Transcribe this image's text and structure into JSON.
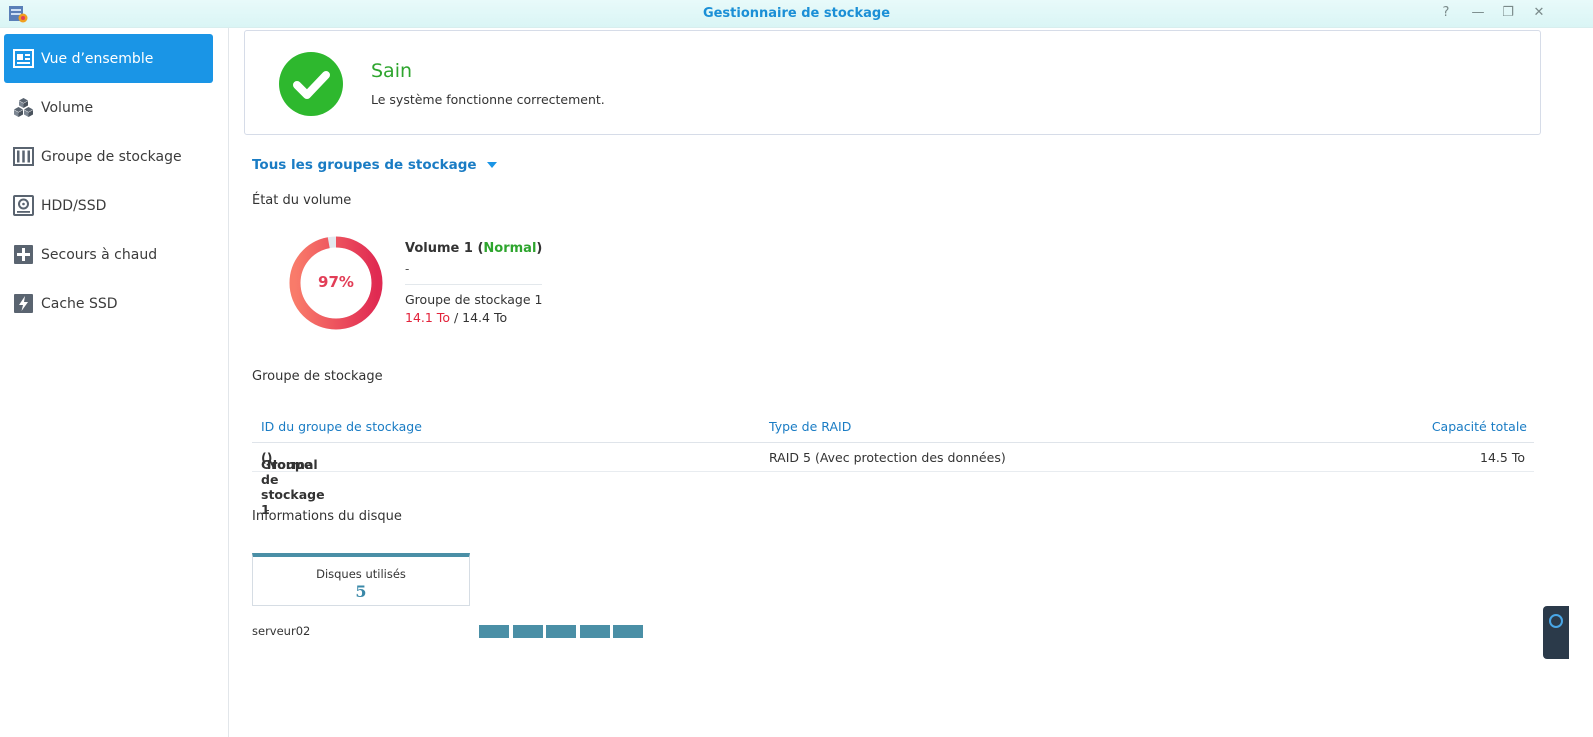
{
  "window": {
    "title": "Gestionnaire de stockage",
    "controls": {
      "help": "?",
      "minimize": "—",
      "restore": "❐",
      "close": "✕"
    }
  },
  "sidebar": {
    "items": [
      {
        "label": "Vue d’ensemble",
        "icon": "overview-icon",
        "active": true
      },
      {
        "label": "Volume",
        "icon": "volume-icon"
      },
      {
        "label": "Groupe de stockage",
        "icon": "storage-pool-icon"
      },
      {
        "label": "HDD/SSD",
        "icon": "hdd-icon"
      },
      {
        "label": "Secours à chaud",
        "icon": "hot-spare-icon"
      },
      {
        "label": "Cache SSD",
        "icon": "ssd-cache-icon"
      }
    ]
  },
  "status": {
    "title": "Sain",
    "description": "Le système fonctionne correctement.",
    "icon": "checkmark-icon",
    "color": "#2eb82e"
  },
  "groups_filter": {
    "label": "Tous les groupes de stockage"
  },
  "volume_section": {
    "title": "État du volume",
    "usage_percent": 97,
    "usage_label": "97%",
    "volume_name": "Volume 1",
    "volume_status": "Normal",
    "description": "-",
    "pool_name": "Groupe de stockage 1",
    "used": "14.1 To",
    "total": "14.4 To"
  },
  "pool_section": {
    "title": "Groupe de stockage",
    "columns": [
      "ID du groupe de stockage",
      "Type de RAID",
      "Capacité totale"
    ],
    "rows": [
      {
        "id": "Groupe de stockage 1",
        "status": "Normal",
        "raid": "RAID 5 (Avec protection des données)",
        "capacity": "14.5 To"
      }
    ]
  },
  "disk_section": {
    "title": "Informations du disque",
    "used_label": "Disques utilisés",
    "used_count": "5",
    "server": "serveur02",
    "disk_count": 5,
    "accent": "#4a8fa6"
  }
}
